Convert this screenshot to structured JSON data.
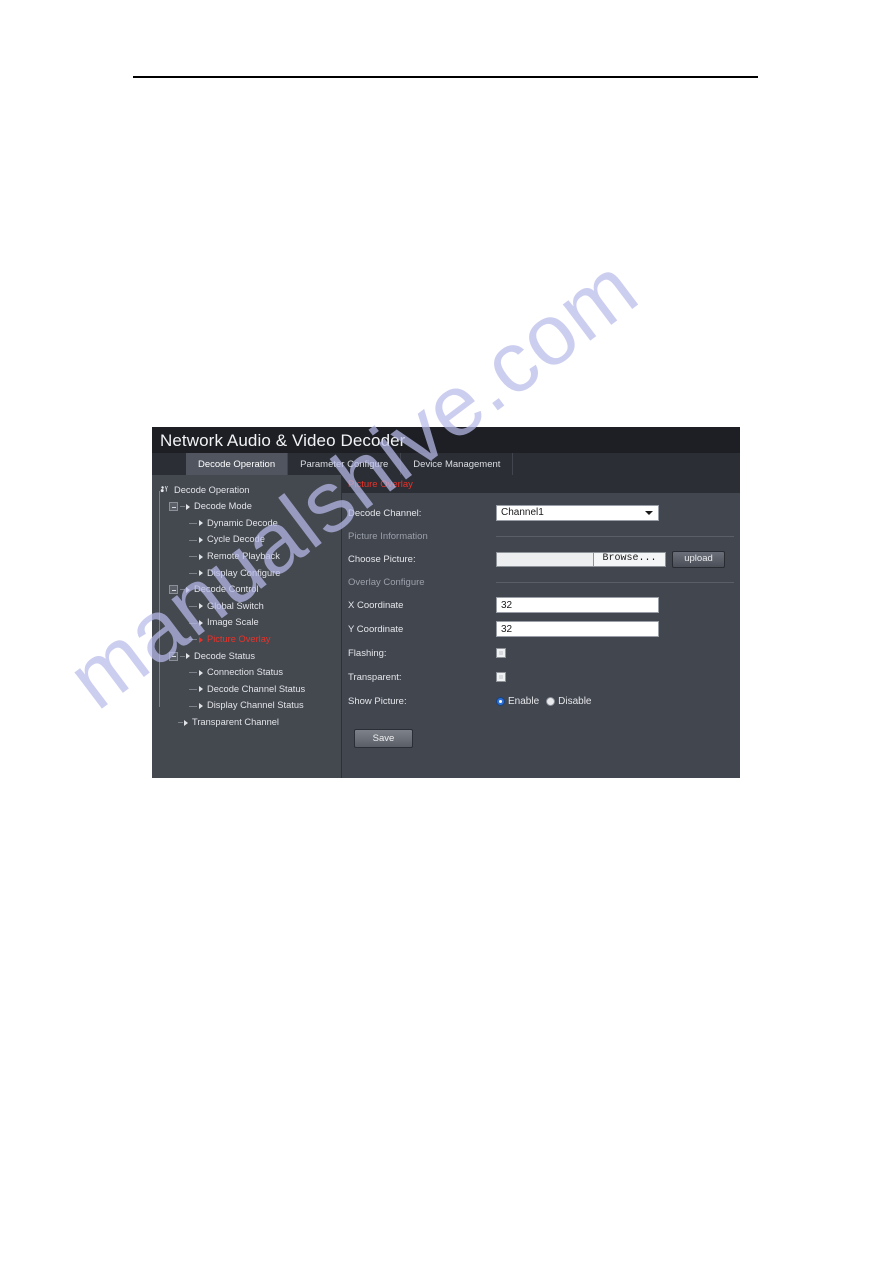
{
  "document": {
    "has_top_rule": true,
    "watermark_text": "manualshive.com",
    "watermark_color": "#b9bcea"
  },
  "app": {
    "title": "Network Audio & Video Decoder",
    "accent_red": "#e8332a",
    "header_bg": "#1d1f24",
    "body_bg": "#42464f",
    "sidebar_bg": "#44484f",
    "tabs": [
      {
        "label": "Decode Operation",
        "active": true
      },
      {
        "label": "Parameter Configure",
        "active": false
      },
      {
        "label": "Device Management",
        "active": false
      }
    ],
    "breadcrumb": "Picture Overlay",
    "sidebar": {
      "items": [
        {
          "label": "Decode Operation",
          "level": 0,
          "kind": "root",
          "selected": false
        },
        {
          "label": "Decode Mode",
          "level": 1,
          "kind": "branch",
          "selected": false
        },
        {
          "label": "Dynamic Decode",
          "level": 2,
          "kind": "leaf",
          "selected": false
        },
        {
          "label": "Cycle Decode",
          "level": 2,
          "kind": "leaf",
          "selected": false
        },
        {
          "label": "Remote Playback",
          "level": 2,
          "kind": "leaf",
          "selected": false
        },
        {
          "label": "Display Configure",
          "level": 2,
          "kind": "leaf-last",
          "selected": false
        },
        {
          "label": "Decode Control",
          "level": 1,
          "kind": "branch",
          "selected": false
        },
        {
          "label": "Global Switch",
          "level": 2,
          "kind": "leaf",
          "selected": false
        },
        {
          "label": "Image Scale",
          "level": 2,
          "kind": "leaf",
          "selected": false
        },
        {
          "label": "Picture Overlay",
          "level": 2,
          "kind": "leaf-last",
          "selected": true
        },
        {
          "label": "Decode Status",
          "level": 1,
          "kind": "branch",
          "selected": false
        },
        {
          "label": "Connection Status",
          "level": 2,
          "kind": "leaf",
          "selected": false
        },
        {
          "label": "Decode Channel Status",
          "level": 2,
          "kind": "leaf",
          "selected": false
        },
        {
          "label": "Display Channel Status",
          "level": 2,
          "kind": "leaf-last",
          "selected": false
        },
        {
          "label": "Transparent Channel",
          "level": 1,
          "kind": "leaf-plain",
          "selected": false
        }
      ]
    },
    "form": {
      "decode_channel_label": "Decode Channel:",
      "decode_channel_value": "Channel1",
      "decode_channel_options": [
        "Channel1"
      ],
      "picture_information_section": "Picture Information",
      "choose_picture_label": "Choose Picture:",
      "choose_picture_value": "",
      "choose_picture_placeholder": "",
      "browse_label": "Browse...",
      "upload_label": "upload",
      "overlay_configure_section": "Overlay Configure",
      "x_coordinate_label": "X Coordinate",
      "x_coordinate_value": "32",
      "y_coordinate_label": "Y Coordinate",
      "y_coordinate_value": "32",
      "flashing_label": "Flashing:",
      "flashing_checked": false,
      "transparent_label": "Transparent:",
      "transparent_checked": false,
      "show_picture_label": "Show Picture:",
      "show_picture_enable_label": "Enable",
      "show_picture_disable_label": "Disable",
      "show_picture_selected": "Enable",
      "save_label": "Save"
    }
  }
}
